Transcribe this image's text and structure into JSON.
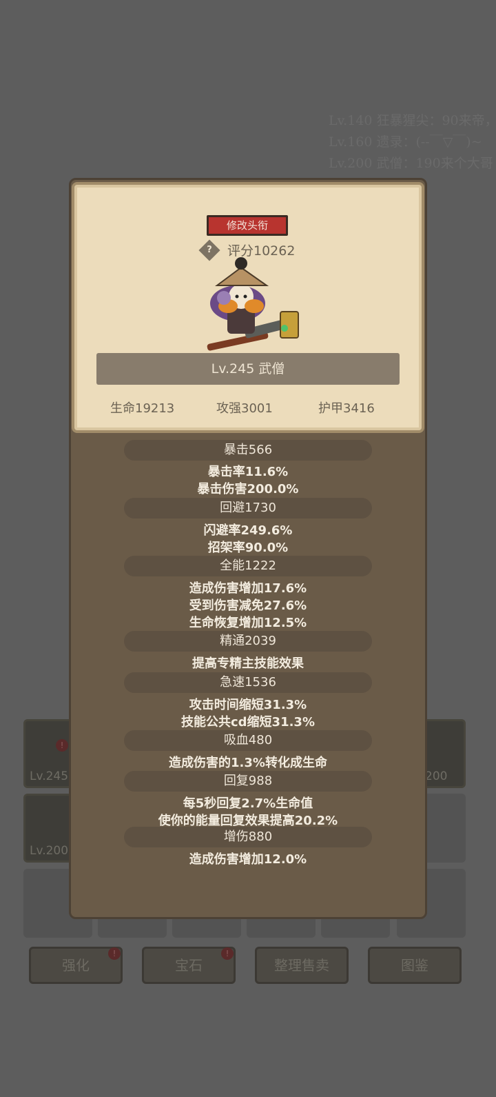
{
  "background": {
    "notes": [
      "Lv.140 狂暴猩尖：90来帝，",
      "Lv.160 遗录：(--￣▽￣)~",
      "Lv.200 武僧：190来个大哥"
    ],
    "slots": [
      {
        "level": "Lv.245"
      },
      {
        "level": "Lv.200"
      },
      {
        "level": "200"
      }
    ],
    "buttons": [
      "强化",
      "宝石",
      "整理售卖",
      "图鉴"
    ]
  },
  "card": {
    "rename_label": "修改头衔",
    "score_icon": "?",
    "score": "评分10262",
    "name": "Lv.245 武僧",
    "base_stats": [
      "生命19213",
      "攻强3001",
      "护甲3416"
    ]
  },
  "stats": [
    {
      "header": "暴击566",
      "lines": [
        "暴击率11.6%",
        "暴击伤害200.0%"
      ]
    },
    {
      "header": "回避1730",
      "lines": [
        "闪避率249.6%",
        "招架率90.0%"
      ]
    },
    {
      "header": "全能1222",
      "lines": [
        "造成伤害增加17.6%",
        "受到伤害减免27.6%",
        "生命恢复增加12.5%"
      ]
    },
    {
      "header": "精通2039",
      "lines": [
        "提高专精主技能效果"
      ]
    },
    {
      "header": "急速1536",
      "lines": [
        "攻击时间缩短31.3%",
        "技能公共cd缩短31.3%"
      ]
    },
    {
      "header": "吸血480",
      "lines": [
        "造成伤害的1.3%转化成生命"
      ]
    },
    {
      "header": "回复988",
      "lines": [
        "每5秒回复2.7%生命值",
        "使你的能量回复效果提高20.2%"
      ]
    },
    {
      "header": "增伤880",
      "lines": [
        "造成伤害增加12.0%"
      ]
    }
  ],
  "colors": {
    "rename_button": "#b8342f",
    "modal_bg": "#6a5b48",
    "card_bg": "#ecdcbb"
  }
}
